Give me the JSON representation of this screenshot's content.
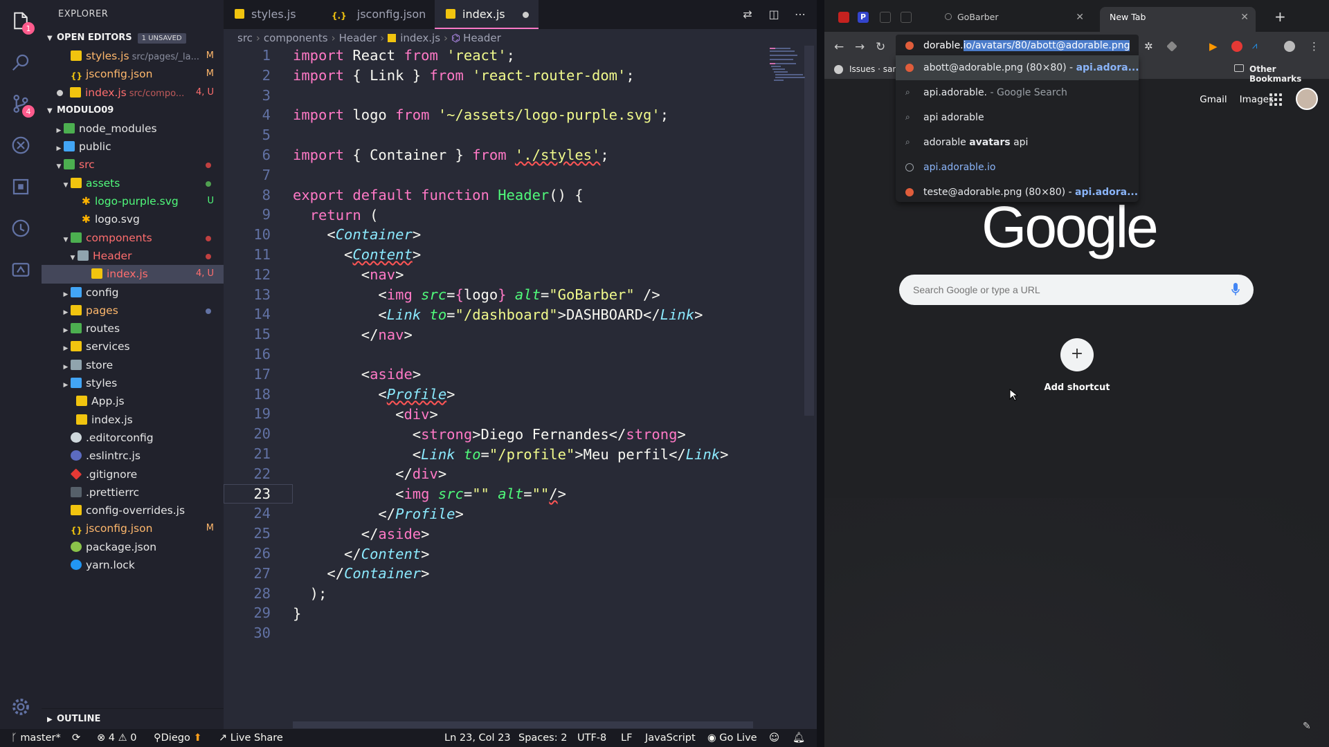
{
  "explorer": {
    "title": "EXPLORER",
    "open_editors_label": "OPEN EDITORS",
    "unsaved_badge": "1 UNSAVED",
    "open_editors": [
      {
        "name": "styles.js",
        "hint": "src/pages/_la...",
        "status": "M",
        "icon": "js-file-icon"
      },
      {
        "name": "jsconfig.json",
        "hint": "",
        "status": "M",
        "icon": "json-file-icon"
      },
      {
        "name": "index.js",
        "hint": "src/compo...",
        "status": "4, U",
        "icon": "js-file-icon"
      }
    ],
    "project_label": "MODULO09",
    "tree": [
      {
        "name": "node_modules"
      },
      {
        "name": "public"
      },
      {
        "name": "src"
      },
      {
        "name": "assets"
      },
      {
        "name": "logo-purple.svg",
        "status": "U"
      },
      {
        "name": "logo.svg"
      },
      {
        "name": "components"
      },
      {
        "name": "Header"
      },
      {
        "name": "index.js",
        "status": "4, U"
      },
      {
        "name": "config"
      },
      {
        "name": "pages"
      },
      {
        "name": "routes"
      },
      {
        "name": "services"
      },
      {
        "name": "store"
      },
      {
        "name": "styles"
      },
      {
        "name": "App.js"
      },
      {
        "name": "index.js"
      },
      {
        "name": ".editorconfig"
      },
      {
        "name": ".eslintrc.js"
      },
      {
        "name": ".gitignore"
      },
      {
        "name": ".prettierrc"
      },
      {
        "name": "config-overrides.js"
      },
      {
        "name": "jsconfig.json",
        "status": "M"
      },
      {
        "name": "package.json"
      },
      {
        "name": "yarn.lock"
      }
    ],
    "outline_label": "OUTLINE"
  },
  "activity": {
    "explorer_badge": "1",
    "scm_badge": "4"
  },
  "tabs": [
    {
      "label": "styles.js"
    },
    {
      "label": "jsconfig.json"
    },
    {
      "label": "index.js"
    }
  ],
  "breadcrumbs": [
    "src",
    "components",
    "Header",
    "index.js",
    "Header"
  ],
  "line_numbers": [
    "1",
    "2",
    "3",
    "4",
    "5",
    "6",
    "7",
    "8",
    "9",
    "10",
    "11",
    "12",
    "13",
    "14",
    "15",
    "16",
    "17",
    "18",
    "19",
    "20",
    "21",
    "22",
    "23",
    "24",
    "25",
    "26",
    "27",
    "28",
    "29",
    "30"
  ],
  "status": {
    "branch": "master*",
    "errors": "4",
    "warnings": "0",
    "user": "Diego",
    "live_share": "Live Share",
    "position": "Ln 23, Col 23",
    "spaces": "Spaces: 2",
    "encoding": "UTF-8",
    "eol": "LF",
    "language": "JavaScript",
    "go_live": "Go Live"
  },
  "browser": {
    "tabs": [
      {
        "label": "GoBarber"
      },
      {
        "label": "New Tab"
      }
    ],
    "omnibox_prefix": "dorable.",
    "omnibox_selected": "io/avatars/80/abott@adorable.png",
    "bookmark_issues": "Issues · san",
    "other_bookmarks": "Other Bookmarks",
    "suggestions": [
      {
        "main": "abott@adorable.png (80×80) - ",
        "url": "api.adora..."
      },
      {
        "main": "api.adorable.",
        "rest": " - Google Search"
      },
      {
        "main": "api adorable"
      },
      {
        "main": "adorable ",
        "bold": "avatars",
        "rest": " api"
      },
      {
        "url": "api.adorable.io"
      },
      {
        "main": "teste@adorable.png (80×80) - ",
        "url": "api.adora..."
      }
    ],
    "gmail": "Gmail",
    "images": "Images",
    "logo": "Google",
    "search_placeholder": "Search Google or type a URL",
    "add_shortcut": "Add shortcut"
  }
}
